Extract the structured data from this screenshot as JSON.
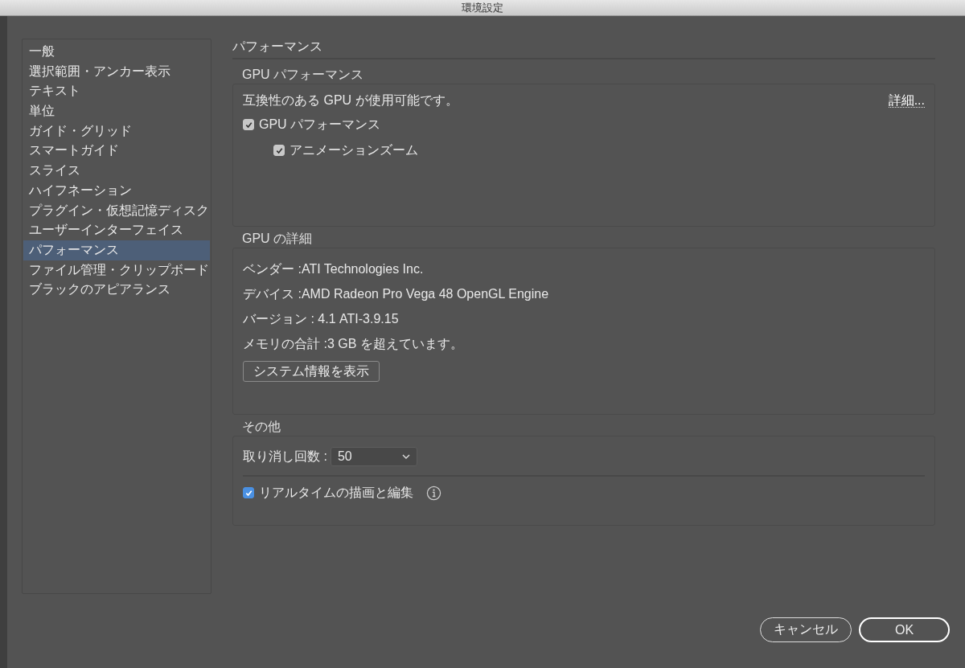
{
  "window": {
    "title": "環境設定"
  },
  "sidebar": {
    "items": [
      {
        "label": "一般",
        "selected": false
      },
      {
        "label": "選択範囲・アンカー表示",
        "selected": false
      },
      {
        "label": "テキスト",
        "selected": false
      },
      {
        "label": "単位",
        "selected": false
      },
      {
        "label": "ガイド・グリッド",
        "selected": false
      },
      {
        "label": "スマートガイド",
        "selected": false
      },
      {
        "label": "スライス",
        "selected": false
      },
      {
        "label": "ハイフネーション",
        "selected": false
      },
      {
        "label": "プラグイン・仮想記憶ディスク",
        "selected": false
      },
      {
        "label": "ユーザーインターフェイス",
        "selected": false
      },
      {
        "label": "パフォーマンス",
        "selected": true
      },
      {
        "label": "ファイル管理・クリップボード",
        "selected": false
      },
      {
        "label": "ブラックのアピアランス",
        "selected": false
      }
    ]
  },
  "page_title": "パフォーマンス",
  "gpu_performance": {
    "title": "GPU パフォーマンス",
    "message": "互換性のある GPU が使用可能です。",
    "details_link": "詳細...",
    "checkboxes": [
      {
        "label": "GPU パフォーマンス",
        "checked": true,
        "color": "#c8c8c8"
      },
      {
        "label": "アニメーションズーム",
        "checked": true,
        "color": "#c8c8c8"
      }
    ]
  },
  "gpu_details": {
    "title": "GPU の詳細",
    "lines": [
      "ベンダー :ATI Technologies Inc.",
      "デバイス :AMD Radeon Pro Vega 48 OpenGL Engine",
      "バージョン : 4.1 ATI-3.9.15",
      "メモリの合計 :3 GB を超えています。"
    ],
    "button": "システム情報を表示"
  },
  "other": {
    "title": "その他",
    "undo_label": "取り消し回数 :",
    "undo_value": "50",
    "checkbox": {
      "label": "リアルタイムの描画と編集",
      "checked": true,
      "color": "#4a90e2"
    }
  },
  "buttons": {
    "cancel": "キャンセル",
    "ok": "OK"
  }
}
